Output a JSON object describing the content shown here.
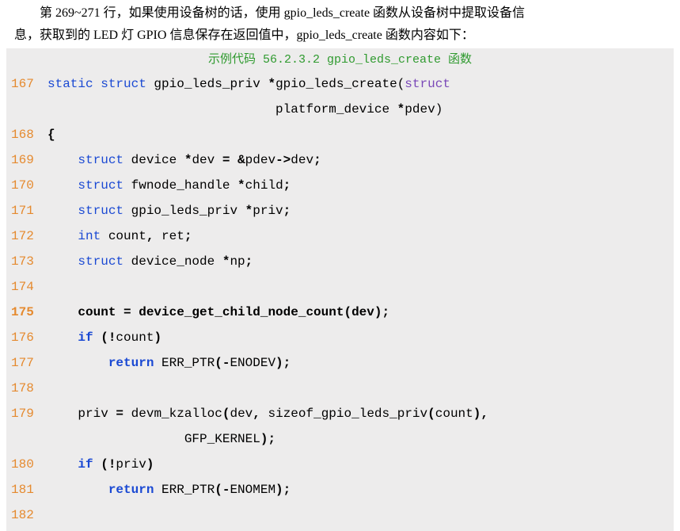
{
  "prose": {
    "line1": "第 269~271 行，如果使用设备树的话，使用 gpio_leds_create 函数从设备树中提取设备信",
    "line2": "息，获取到的 LED 灯 GPIO 信息保存在返回值中，gpio_leds_create 函数内容如下："
  },
  "caption": "示例代码 56.2.3.2 gpio_leds_create 函数",
  "lines": {
    "l167_no": "167",
    "l167_a": "static",
    "l167_b": " ",
    "l167_c": "struct",
    "l167_d": " gpio_leds_priv ",
    "l167_e": "*",
    "l167_f": "gpio_leds_create",
    "l167_g": "(",
    "l167_h": "struct",
    "l167x": "                              platform_device ",
    "l167y": "*",
    "l167z": "pdev)",
    "l168_no": "168",
    "l168": "{",
    "l169_no": "169",
    "l169_a": "struct",
    "l169_b": " device ",
    "l169_c": "*",
    "l169_d": "dev ",
    "l169_e": "=",
    "l169_f": " ",
    "l169_g": "&",
    "l169_h": "pdev",
    "l169_i": "->",
    "l169_j": "dev",
    "l169_k": ";",
    "l170_no": "170",
    "l170_a": "struct",
    "l170_b": " fwnode_handle ",
    "l170_c": "*",
    "l170_d": "child",
    "l170_e": ";",
    "l171_no": "171",
    "l171_a": "struct",
    "l171_b": " gpio_leds_priv ",
    "l171_c": "*",
    "l171_d": "priv",
    "l171_e": ";",
    "l172_no": "172",
    "l172_a": "int",
    "l172_b": " count",
    "l172_c": ",",
    "l172_d": " ret",
    "l172_e": ";",
    "l173_no": "173",
    "l173_a": "struct",
    "l173_b": " device_node ",
    "l173_c": "*",
    "l173_d": "np",
    "l173_e": ";",
    "l174_no": "174",
    "l175_no": "175",
    "l175": "count = device_get_child_node_count(dev);",
    "l176_no": "176",
    "l176_a": "if",
    "l176_b": " (!",
    "l176_c": "count",
    "l176_d": ")",
    "l177_no": "177",
    "l177_a": "return",
    "l177_b": " ERR_PTR",
    "l177_c": "(-",
    "l177_d": "ENODEV",
    "l177_e": ");",
    "l178_no": "178",
    "l179_no": "179",
    "l179_a": "priv ",
    "l179_b": "=",
    "l179_c": " devm_kzalloc",
    "l179_d": "(",
    "l179_e": "dev",
    "l179_f": ",",
    "l179_g": " sizeof_gpio_leds_priv",
    "l179_h": "(",
    "l179_i": "count",
    "l179_j": "),",
    "l179x": "              GFP_KERNEL",
    "l179y": ");",
    "l180_no": "180",
    "l180_a": "if",
    "l180_b": " (!",
    "l180_c": "priv",
    "l180_d": ")",
    "l181_no": "181",
    "l181_a": "return",
    "l181_b": " ERR_PTR",
    "l181_c": "(-",
    "l181_d": "ENOMEM",
    "l181_e": ");",
    "l182_no": "182"
  }
}
